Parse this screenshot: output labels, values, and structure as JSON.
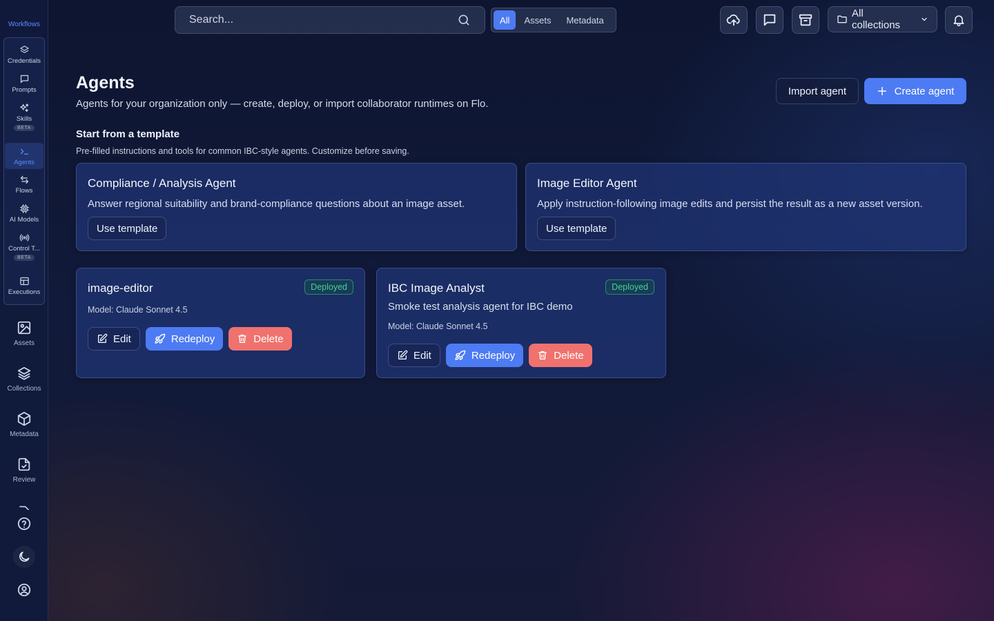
{
  "sidebar": {
    "workflows_label": "Workflows",
    "workflow_items": [
      {
        "label": "Credentials",
        "icon": "layers-icon",
        "badge": ""
      },
      {
        "label": "Prompts",
        "icon": "message-square-icon",
        "badge": ""
      },
      {
        "label": "Skills",
        "icon": "sparkles-icon",
        "badge": "BETA"
      },
      {
        "label": "Agents",
        "icon": "terminal-icon",
        "badge": "",
        "active": true
      },
      {
        "label": "Flows",
        "icon": "arrows-left-right-icon",
        "badge": ""
      },
      {
        "label": "AI Models",
        "icon": "cpu-icon",
        "badge": ""
      },
      {
        "label": "Control T...",
        "icon": "radio-icon",
        "badge": "BETA"
      },
      {
        "label": "Executions",
        "icon": "table-icon",
        "badge": ""
      }
    ],
    "main_items": [
      {
        "label": "Assets",
        "icon": "image-icon"
      },
      {
        "label": "Collections",
        "icon": "layers-icon"
      },
      {
        "label": "Metadata",
        "icon": "box-icon"
      },
      {
        "label": "Review",
        "icon": "file-check-icon"
      }
    ],
    "bottom": [
      "help-icon",
      "moon-icon",
      "user-circle-icon"
    ]
  },
  "topbar": {
    "search_placeholder": "Search...",
    "filters": [
      "All",
      "Assets",
      "Metadata"
    ],
    "active_filter": "All",
    "collections_label": "All collections"
  },
  "header": {
    "title": "Agents",
    "subtitle": "Agents for your organization only — create, deploy, or import collaborator runtimes on Flo.",
    "import_label": "Import agent",
    "create_label": "Create agent"
  },
  "templates": {
    "title": "Start from a template",
    "subtitle": "Pre-filled instructions and tools for common IBC-style agents. Customize before saving.",
    "items": [
      {
        "title": "Compliance / Analysis Agent",
        "description": "Answer regional suitability and brand-compliance questions about an image asset.",
        "button": "Use template"
      },
      {
        "title": "Image Editor Agent",
        "description": "Apply instruction-following image edits and persist the result as a new asset version.",
        "button": "Use template"
      }
    ]
  },
  "agents": [
    {
      "name": "image-editor",
      "status": "Deployed",
      "description": "",
      "model": "Model: Claude Sonnet 4.5",
      "edit": "Edit",
      "redeploy": "Redeploy",
      "delete": "Delete"
    },
    {
      "name": "IBC Image Analyst",
      "status": "Deployed",
      "description": "Smoke test analysis agent for IBC demo",
      "model": "Model: Claude Sonnet 4.5",
      "edit": "Edit",
      "redeploy": "Redeploy",
      "delete": "Delete"
    }
  ],
  "colors": {
    "accent": "#4d7bf3",
    "danger": "#f0726e",
    "success": "#42d48a",
    "active_nav": "#5b8cff"
  }
}
